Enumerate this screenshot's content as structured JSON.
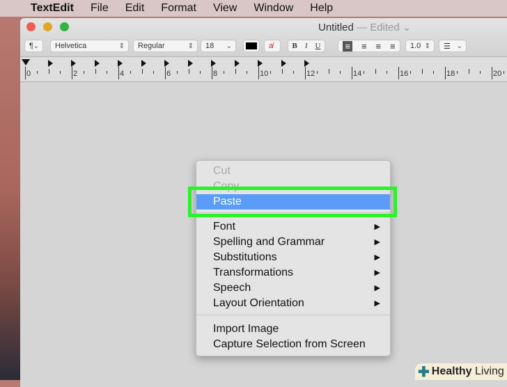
{
  "menubar": {
    "app": "TextEdit",
    "items": [
      "File",
      "Edit",
      "Format",
      "View",
      "Window",
      "Help"
    ]
  },
  "window": {
    "title": "Untitled",
    "status": "— Edited"
  },
  "toolbar": {
    "paragraph": "¶",
    "font": "Helvetica",
    "style": "Regular",
    "size": "18",
    "bold": "B",
    "italic": "I",
    "underline": "U",
    "spacing": "1.0",
    "text_color": "#000000"
  },
  "ruler": {
    "labels": [
      "0",
      "2",
      "4",
      "6",
      "8",
      "10",
      "12",
      "14",
      "16",
      "18",
      "20"
    ]
  },
  "context_menu": {
    "items": [
      {
        "label": "Cut",
        "disabled": true
      },
      {
        "label": "Copy",
        "disabled": true
      },
      {
        "label": "Paste",
        "highlighted": true
      },
      {
        "label": "Font",
        "submenu": true
      },
      {
        "label": "Spelling and Grammar",
        "submenu": true
      },
      {
        "label": "Substitutions",
        "submenu": true
      },
      {
        "label": "Transformations",
        "submenu": true
      },
      {
        "label": "Speech",
        "submenu": true
      },
      {
        "label": "Layout Orientation",
        "submenu": true
      },
      {
        "label": "Import Image"
      },
      {
        "label": "Capture Selection from Screen"
      }
    ]
  },
  "highlight_color": "#2bf22b",
  "watermark": {
    "text1": "Healthy",
    "text2": "Living"
  }
}
